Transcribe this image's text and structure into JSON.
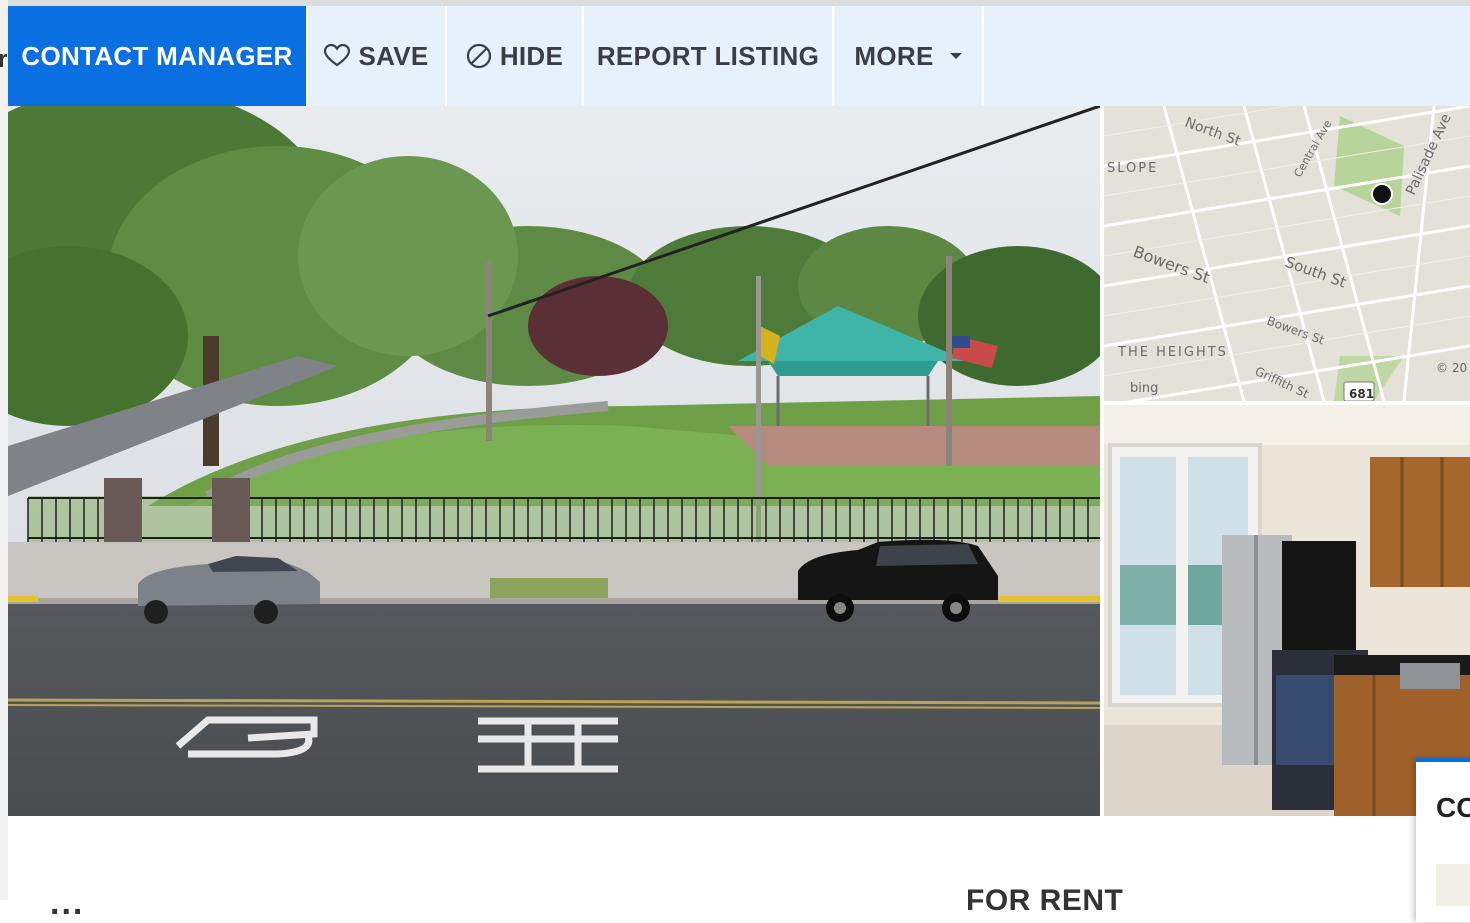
{
  "left_edge_char": "r",
  "actions": {
    "contact_manager": "CONTACT MANAGER",
    "save": "SAVE",
    "hide": "HIDE",
    "report_listing": "REPORT LISTING",
    "more": "MORE"
  },
  "map": {
    "labels": [
      "North St",
      "Central Ave",
      "Palisade Ave",
      "SLOPE",
      "Bowers St",
      "South St",
      "Bowers St",
      "THE HEIGHTS",
      "Griffith St"
    ],
    "route_shield": "681",
    "attribution": "bing",
    "copyright": "© 20"
  },
  "bottom": {
    "address_partial": "...",
    "status_partial": "FOR RENT"
  },
  "contact_card": {
    "title": "CO"
  },
  "colors": {
    "primary": "#0a6fe0",
    "actionbar_bg": "#e6f1fb",
    "text_dark": "#3b3f45"
  },
  "icons": {
    "save": "heart-outline-icon",
    "hide": "circle-slash-icon",
    "more": "caret-down-icon"
  }
}
